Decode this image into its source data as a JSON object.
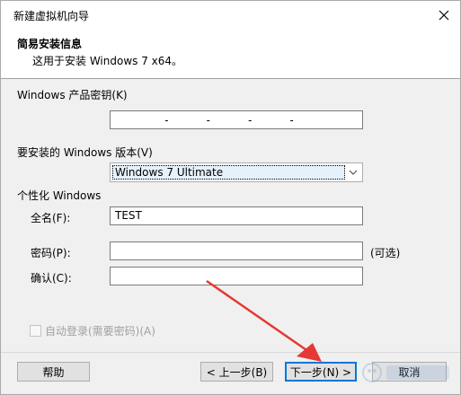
{
  "window": {
    "title": "新建虚拟机向导"
  },
  "header": {
    "title": "简易安装信息",
    "subtitle": "这用于安装 Windows 7 x64。"
  },
  "product_key": {
    "label": "Windows 产品密钥(K)",
    "value": "-  -  -  -"
  },
  "version": {
    "label": "要安装的 Windows 版本(V)",
    "selected": "Windows 7 Ultimate"
  },
  "personalize": {
    "group_label": "个性化 Windows",
    "fullname_label": "全名(F):",
    "fullname_value": "TEST",
    "password_label": "密码(P):",
    "password_value": "",
    "optional_note": "(可选)",
    "confirm_label": "确认(C):",
    "confirm_value": ""
  },
  "autologin": {
    "label": "自动登录(需要密码)(A)",
    "checked": false,
    "disabled": true
  },
  "buttons": {
    "help": "帮助",
    "back": "< 上一步(B)",
    "next": "下一步(N) >",
    "cancel": "取消"
  },
  "annotation": {
    "arrow_color": "#e53935"
  }
}
